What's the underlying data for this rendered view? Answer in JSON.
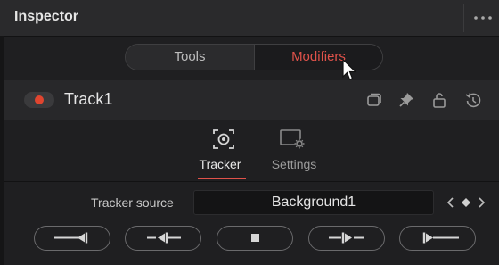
{
  "panel": {
    "title": "Inspector",
    "more_icon": "more-horizontal-icon"
  },
  "segmented": {
    "tools_label": "Tools",
    "modifiers_label": "Modifiers",
    "selected": "Modifiers"
  },
  "node": {
    "name": "Track1",
    "enabled": true,
    "icons": [
      "versions-icon",
      "pin-icon",
      "lock-icon",
      "reset-icon"
    ]
  },
  "tabs": [
    {
      "label": "Tracker",
      "icon": "tracker-icon",
      "active": true
    },
    {
      "label": "Settings",
      "icon": "settings-icon",
      "active": false
    }
  ],
  "tracker_source": {
    "label": "Tracker source",
    "value": "Background1"
  },
  "transport": [
    {
      "name": "track-to-start",
      "icon": "track-to-start-icon"
    },
    {
      "name": "track-backward",
      "icon": "track-backward-icon"
    },
    {
      "name": "stop-tracking",
      "icon": "stop-icon"
    },
    {
      "name": "track-forward",
      "icon": "track-forward-icon"
    },
    {
      "name": "track-to-end",
      "icon": "track-to-end-icon"
    }
  ],
  "colors": {
    "accent": "#e0524a",
    "toggle_dot": "#e0452f",
    "background": "#1f1f21"
  }
}
